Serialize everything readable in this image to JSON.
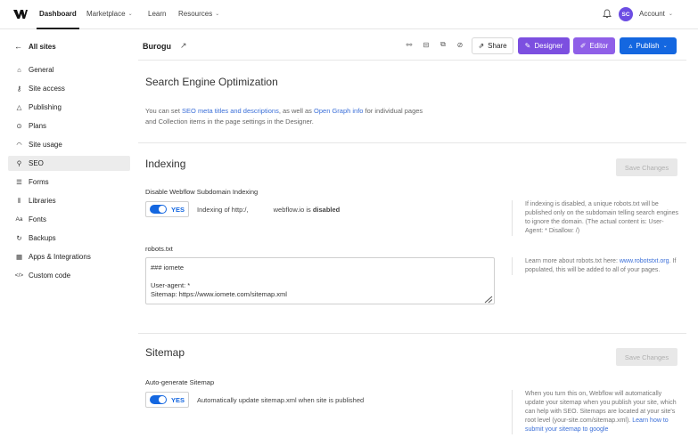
{
  "topnav": {
    "logo_icon": "webflow-logo-icon",
    "items": [
      {
        "label": "Dashboard",
        "active": true
      },
      {
        "label": "Marketplace",
        "dropdown": true
      },
      {
        "label": "Learn"
      },
      {
        "label": "Resources",
        "dropdown": true
      }
    ],
    "avatar_initials": "SC",
    "account_label": "Account"
  },
  "sidebar": {
    "back_label": "All sites",
    "items": [
      {
        "label": "General",
        "icon": "home-icon"
      },
      {
        "label": "Site access",
        "icon": "key-icon"
      },
      {
        "label": "Publishing",
        "icon": "publish-icon"
      },
      {
        "label": "Plans",
        "icon": "plans-icon"
      },
      {
        "label": "Site usage",
        "icon": "gauge-icon"
      },
      {
        "label": "SEO",
        "icon": "search-icon",
        "active": true
      },
      {
        "label": "Forms",
        "icon": "forms-icon"
      },
      {
        "label": "Libraries",
        "icon": "libraries-icon"
      },
      {
        "label": "Fonts",
        "icon": "fonts-icon"
      },
      {
        "label": "Backups",
        "icon": "backups-icon"
      },
      {
        "label": "Apps & Integrations",
        "icon": "apps-icon"
      },
      {
        "label": "Custom code",
        "icon": "code-icon"
      }
    ]
  },
  "header": {
    "site_name": "Burogu",
    "share_label": "Share",
    "designer_label": "Designer",
    "editor_label": "Editor",
    "publish_label": "Publish"
  },
  "seo_intro": {
    "title": "Search Engine Optimization",
    "text_1": "You can set ",
    "link_1": "SEO meta titles and descriptions",
    "text_2": ", as well as ",
    "link_2": "Open Graph info",
    "text_3": " for individual pages",
    "text_4": "and Collection items in the page settings in the Designer."
  },
  "indexing": {
    "title": "Indexing",
    "save_label": "Save Changes",
    "disable_label": "Disable Webflow Subdomain Indexing",
    "toggle_label": "YES",
    "status_prefix": "Indexing of http:/,",
    "status_domain": "webflow.io is ",
    "status_value": "disabled",
    "help_1": "If indexing is disabled, a unique robots.txt will be published only on the subdomain telling search engines to ignore the domain. (The actual content is: User-Agent: * Disallow: /)",
    "robots_label": "robots.txt",
    "robots_content": "### iomete\n\nUser-agent: *\nSitemap: https://www.iomete.com/sitemap.xml",
    "help_2_text": "Learn more about robots.txt here: ",
    "help_2_link": "www.robotstxt.org",
    "help_2_rest": ". If populated, this will be added to all of your pages."
  },
  "sitemap": {
    "title": "Sitemap",
    "save_label": "Save Changes",
    "auto_label": "Auto-generate Sitemap",
    "toggle_label": "YES",
    "desc": "Automatically update sitemap.xml when site is published",
    "help_text": "When you turn this on, Webflow will automatically update your sitemap when you publish your site, which can help with SEO. Sitemaps are located at your site's root level (your-site.com/sitemap.xml). ",
    "help_link": "Learn how to submit your sitemap to google"
  },
  "colors": {
    "accent_blue": "#1467e0",
    "designer_purple": "#7c4fe0",
    "editor_purple": "#8f5fe8",
    "avatar_purple": "#6c4de3"
  }
}
